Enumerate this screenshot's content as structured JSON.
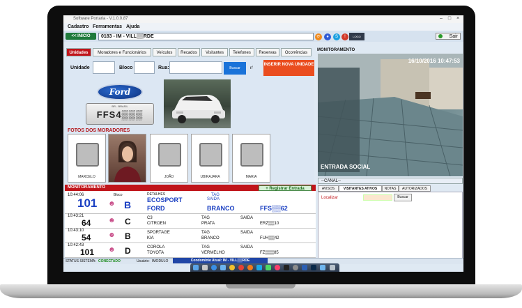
{
  "window": {
    "title": "Software Portaria - V.1.0.0.87"
  },
  "menu": [
    "Cadastro",
    "Ferramentas",
    "Ajuda"
  ],
  "toolbar": {
    "inicio_label": "<< INICIO",
    "condominio": "0183 - IM - VILL▒▒RDE",
    "sair_label": "Sair"
  },
  "tabs": [
    "Unidades",
    "Moradores e Funcionários",
    "Veículos",
    "Recados",
    "Visitantes",
    "Telefones",
    "Reservas",
    "Ocorrências"
  ],
  "search": {
    "unidade_label": "Unidade",
    "bloco_label": "Bloco",
    "rua_label": "Rua:",
    "buscar_label": "Buscar",
    "rua_suffix": "r/"
  },
  "inserir_unidade": "INSERIR NOVA UNIDADE",
  "vehicle": {
    "brand_logo": "Ford",
    "plate_top": "BR - BRASIL",
    "plate": "FFS4▒▒▒"
  },
  "fotos_title": "FOTOS DOS MORADORES",
  "residents": [
    {
      "name": "MARCELO"
    },
    {
      "name": ""
    },
    {
      "name": "JOÃO"
    },
    {
      "name": "UBIRAJARA"
    },
    {
      "name": "MARIA"
    }
  ],
  "monitoramento": {
    "title": "MONITORAMENTO",
    "camera_timestamp": "16/10/2016 10:47:53",
    "camera_label": "ENTRADA SOCIAL",
    "canal_label": "--CANAL--",
    "right_tabs": [
      "AVISOS",
      "VISITANTES ATIVOS",
      "NOTAS",
      "AUTORIZADOS"
    ],
    "localizar_label": "Localizar",
    "buscar_label": "Buscar"
  },
  "entries_header": {
    "title": "MONITORAMENTO",
    "registrar_label": "+ Registrar Entrada"
  },
  "entries": [
    {
      "time": "10:44:06",
      "apt": "101",
      "bloco_label": "Bloco",
      "bloco": "B",
      "detalhes_label": "DETALHES",
      "car": "ECOSPORT",
      "tag_label": "TAG",
      "saida_label": "SAIDA",
      "brand": "FORD",
      "color": "BRANCO",
      "plate": "FFS▒▒62"
    },
    {
      "time": "10:43:21",
      "apt": "64",
      "bloco": "C",
      "car": "C3",
      "brand": "CITROEN",
      "tag_label": "TAG",
      "color": "PRATA",
      "saida_label": "SAIDA",
      "plate": "ERZ▒▒10"
    },
    {
      "time": "10:43:10",
      "apt": "54",
      "bloco": "B",
      "car": "SPORTAGE",
      "brand": "KIA",
      "tag_label": "TAG",
      "color": "BRANCO",
      "saida_label": "SAIDA",
      "plate": "FUH▒▒42"
    },
    {
      "time": "10:42:43",
      "apt": "101",
      "bloco": "D",
      "car": "COROLA",
      "brand": "TOYOTA",
      "tag_label": "TAG",
      "color": "VERMELHO",
      "saida_label": "SAIDA",
      "plate": "FZ▒▒▒85"
    }
  ],
  "status": {
    "label": "STATUS SISTEMA:",
    "value": "CONECTADO",
    "usuario_label": "Usuário:",
    "usuario": "IMODULO",
    "condominio_atual": "Condominio Atual: IM - VILL▒▒RDE"
  },
  "colors": {
    "accent_red": "#c0141a",
    "inserir_orange": "#ea4d1f",
    "apt_blue": "#1a3fc2",
    "status_green": "#1a8a1a"
  },
  "dock_icons": [
    "finder-icon",
    "launchpad-icon",
    "safari-icon",
    "mail-icon",
    "photos-icon",
    "chrome-icon",
    "firefox-icon",
    "skype-icon",
    "messages-icon",
    "itunes-icon",
    "terminal-icon",
    "settings-icon",
    "word-icon",
    "photoshop-icon",
    "folder-icon",
    "trash-icon"
  ]
}
